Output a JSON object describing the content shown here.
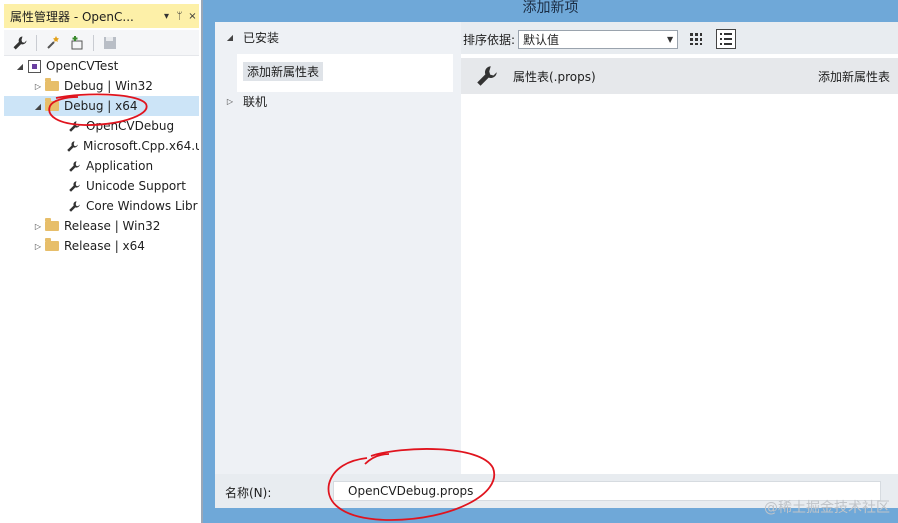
{
  "property_manager": {
    "title": "属性管理器 - OpenC...",
    "title_controls": [
      "▾",
      "ᛘ",
      "×"
    ],
    "toolbar_icons": [
      "wrench-icon",
      "add-new-sheet-icon",
      "add-existing-sheet-icon",
      "save-icon"
    ],
    "tree": [
      {
        "label": "OpenCVTest",
        "level": 0,
        "expander": "◢",
        "icon": "project-icon"
      },
      {
        "label": "Debug | Win32",
        "level": 1,
        "expander": "▷",
        "icon": "folder-icon"
      },
      {
        "label": "Debug | x64",
        "level": 1,
        "expander": "◢",
        "icon": "folder-icon",
        "selected": true
      },
      {
        "label": "OpenCVDebug",
        "level": 2,
        "icon": "wrench-icon"
      },
      {
        "label": "Microsoft.Cpp.x64.u",
        "level": 2,
        "icon": "wrench-icon"
      },
      {
        "label": "Application",
        "level": 2,
        "icon": "wrench-icon"
      },
      {
        "label": "Unicode Support",
        "level": 2,
        "icon": "wrench-icon"
      },
      {
        "label": "Core Windows Libr",
        "level": 2,
        "icon": "wrench-icon"
      },
      {
        "label": "Release | Win32",
        "level": 1,
        "expander": "▷",
        "icon": "folder-icon"
      },
      {
        "label": "Release | x64",
        "level": 1,
        "expander": "▷",
        "icon": "folder-icon"
      }
    ]
  },
  "dialog": {
    "title": "添加新项",
    "categories": {
      "installed": "已安装",
      "installed_sub": "添加新属性表",
      "online": "联机"
    },
    "sort": {
      "label": "排序依据:",
      "value": "默认值"
    },
    "items": [
      {
        "name": "属性表(.props)",
        "description": "添加新属性表",
        "icon": "wrench-icon"
      }
    ],
    "name_field": {
      "label": "名称(N):",
      "value": "OpenCVDebug.props"
    }
  },
  "watermark": "@稀土掘金技术社区",
  "colors": {
    "title_highlight": "#fdf0a8",
    "dialog_frame": "#6fa8d8",
    "selection": "#cce4f7",
    "annotation": "#e0141e"
  }
}
